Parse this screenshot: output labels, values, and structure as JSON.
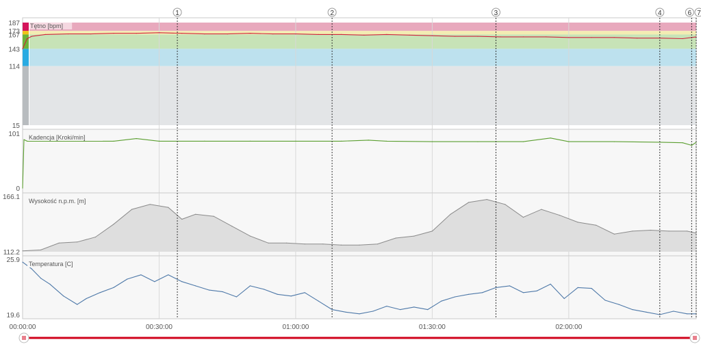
{
  "colors": {
    "heart_line": "#d0223b",
    "cadence_line": "#5a9e2f",
    "altitude_fill": "#dedede",
    "altitude_line": "#8a8a8a",
    "temperature_line": "#4d78a8",
    "zone_red": "#e8a9bd",
    "zone_yellow": "#f3ecb2",
    "zone_green": "#c7e3b7",
    "zone_blue": "#bde1ee",
    "zone_grey": "#e3e5e7",
    "slider": "#d0021b"
  },
  "x_axis": {
    "ticks": [
      "00:00:00",
      "00:30:00",
      "01:00:00",
      "01:30:00",
      "02:00:00"
    ],
    "tick_minutes": [
      0,
      30,
      60,
      90,
      120
    ],
    "range_minutes": [
      0,
      148
    ]
  },
  "laps": {
    "labels": [
      "1",
      "2",
      "3",
      "4",
      "6",
      "7"
    ],
    "minutes": [
      34,
      68,
      104,
      140,
      147,
      148
    ]
  },
  "chart_data": [
    {
      "type": "line",
      "title": "Tętno [bpm]",
      "y_ticks": [
        "187",
        "173",
        "167",
        "143",
        "114",
        "15"
      ],
      "y_tick_values": [
        187,
        173,
        167,
        143,
        114,
        15
      ],
      "ylim": [
        15,
        187
      ],
      "zones": [
        {
          "from": 173,
          "to": 187,
          "color_key": "zone_red"
        },
        {
          "from": 167,
          "to": 173,
          "color_key": "zone_yellow"
        },
        {
          "from": 143,
          "to": 167,
          "color_key": "zone_green"
        },
        {
          "from": 114,
          "to": 143,
          "color_key": "zone_blue"
        },
        {
          "from": 15,
          "to": 114,
          "color_key": "zone_grey"
        }
      ],
      "x": [
        0,
        1,
        2,
        5,
        10,
        15,
        20,
        25,
        30,
        35,
        40,
        45,
        50,
        55,
        60,
        65,
        70,
        75,
        80,
        85,
        90,
        95,
        100,
        105,
        110,
        115,
        120,
        125,
        130,
        135,
        140,
        145,
        148
      ],
      "values": [
        143,
        160,
        164,
        167,
        168,
        168,
        169,
        169,
        170,
        169,
        168,
        168,
        169,
        168,
        168,
        167,
        167,
        166,
        167,
        166,
        165,
        164,
        164,
        163,
        163,
        163,
        162,
        162,
        162,
        161,
        161,
        160,
        163
      ]
    },
    {
      "type": "line",
      "title": "Kadencja [Kroki/min]",
      "y_ticks": [
        "101",
        "0"
      ],
      "y_tick_values": [
        101,
        0
      ],
      "ylim": [
        0,
        101
      ],
      "x": [
        0,
        0.3,
        1,
        10,
        20,
        25,
        30,
        40,
        50,
        60,
        70,
        76,
        80,
        90,
        100,
        110,
        116,
        120,
        130,
        140,
        145,
        147,
        148
      ],
      "values": [
        0,
        93,
        90,
        90,
        90,
        95,
        90,
        90,
        90,
        90,
        90,
        92,
        90,
        89,
        89,
        89,
        96,
        89,
        89,
        88,
        87,
        82,
        88
      ]
    },
    {
      "type": "area",
      "title": "Wysokość n.p.m. [m]",
      "y_ticks": [
        "166.1",
        "112.2"
      ],
      "y_tick_values": [
        166.1,
        112.2
      ],
      "ylim": [
        112.2,
        166.1
      ],
      "x": [
        0,
        4,
        8,
        12,
        16,
        20,
        24,
        28,
        32,
        35,
        38,
        42,
        46,
        50,
        54,
        58,
        62,
        66,
        70,
        74,
        78,
        82,
        86,
        90,
        94,
        98,
        102,
        106,
        110,
        114,
        118,
        122,
        126,
        130,
        134,
        138,
        142,
        146,
        148
      ],
      "values": [
        113,
        114,
        121,
        122,
        127,
        140,
        155,
        160,
        157,
        145,
        150,
        148,
        138,
        128,
        121,
        121,
        120,
        120,
        119,
        119,
        120,
        126,
        128,
        133,
        150,
        162,
        165,
        160,
        147,
        155,
        149,
        142,
        139,
        130,
        133,
        134,
        133,
        133,
        131
      ]
    },
    {
      "type": "line",
      "title": "Temperatura [C]",
      "y_ticks": [
        "25.9",
        "19.6"
      ],
      "y_tick_values": [
        25.9,
        19.6
      ],
      "ylim": [
        19.6,
        25.9
      ],
      "x": [
        0,
        2,
        4,
        6,
        9,
        12,
        14,
        17,
        20,
        23,
        26,
        29,
        32,
        35,
        38,
        41,
        44,
        47,
        50,
        53,
        56,
        59,
        62,
        65,
        68,
        71,
        74,
        77,
        80,
        83,
        86,
        89,
        92,
        95,
        98,
        101,
        104,
        107,
        110,
        113,
        116,
        119,
        122,
        125,
        128,
        131,
        134,
        137,
        140,
        143,
        146,
        148
      ],
      "values": [
        25.8,
        25.0,
        23.9,
        23.2,
        21.8,
        20.8,
        21.5,
        22.2,
        22.8,
        23.8,
        24.3,
        23.5,
        24.3,
        23.5,
        23.0,
        22.5,
        22.3,
        21.7,
        23.0,
        22.6,
        22.0,
        21.8,
        22.2,
        21.2,
        20.2,
        19.9,
        19.7,
        20.0,
        20.6,
        20.2,
        20.5,
        20.2,
        21.2,
        21.7,
        22.0,
        22.2,
        22.8,
        23.0,
        22.2,
        22.4,
        23.2,
        21.5,
        22.8,
        22.7,
        21.3,
        20.8,
        20.2,
        19.9,
        19.6,
        20.0,
        19.7,
        19.7
      ]
    }
  ]
}
